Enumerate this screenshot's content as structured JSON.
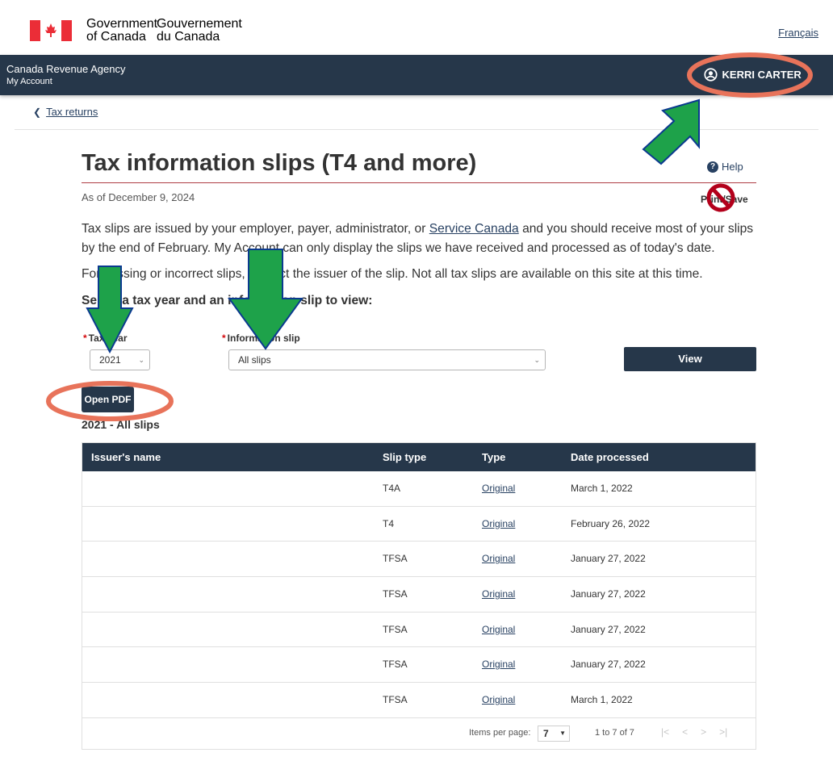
{
  "gov": {
    "name_en_1": "Government",
    "name_en_2": "of Canada",
    "name_fr_1": "Gouvernement",
    "name_fr_2": "du Canada",
    "lang_link": "Français"
  },
  "app_bar": {
    "agency": "Canada Revenue Agency",
    "app_name": "My Account",
    "user_name": "KERRI CARTER"
  },
  "breadcrumb": {
    "link": "Tax returns"
  },
  "page": {
    "title": "Tax information slips (T4 and more)",
    "help": "Help",
    "as_of": "As of December 9, 2024",
    "print_save": "Print/Save",
    "para1_before": "Tax slips are issued by your employer, payer, administrator, or ",
    "para1_link": "Service Canada",
    "para1_after": " and you should receive most of your slips by the end of February. My Account can only display the slips we have received and processed as of today's date.",
    "para2": "For missing or incorrect slips, contact the issuer of the slip. Not all tax slips are available on this site at this time.",
    "select_heading": "Select a tax year and an information slip to view:"
  },
  "form": {
    "tax_year_label": "Tax year",
    "tax_year_value": "2021",
    "slip_label": "Information slip",
    "slip_value": "All slips",
    "view_button": "View",
    "open_pdf_button": "Open PDF"
  },
  "table": {
    "caption": "2021 - All slips",
    "headers": [
      "Issuer's name",
      "Slip type",
      "Type",
      "Date processed"
    ],
    "rows": [
      {
        "issuer": "",
        "slip_type": "T4A",
        "type": "Original",
        "date": "March 1, 2022"
      },
      {
        "issuer": "",
        "slip_type": "T4",
        "type": "Original",
        "date": "February 26, 2022"
      },
      {
        "issuer": "",
        "slip_type": "TFSA",
        "type": "Original",
        "date": "January 27, 2022"
      },
      {
        "issuer": "",
        "slip_type": "TFSA",
        "type": "Original",
        "date": "January 27, 2022"
      },
      {
        "issuer": "",
        "slip_type": "TFSA",
        "type": "Original",
        "date": "January 27, 2022"
      },
      {
        "issuer": "",
        "slip_type": "TFSA",
        "type": "Original",
        "date": "January 27, 2022"
      },
      {
        "issuer": "",
        "slip_type": "TFSA",
        "type": "Original",
        "date": "March 1, 2022"
      }
    ],
    "items_per_page_label": "Items per page:",
    "items_per_page_value": "7",
    "range": "1 to 7 of 7"
  },
  "colors": {
    "header_navy": "#26374a",
    "link_blue": "#284162",
    "title_rule": "#af3c43",
    "annotation_circle": "#e8735a",
    "annotation_arrow": "#1ea24a"
  },
  "icons": [
    "canada-flag-icon",
    "user-circle-icon",
    "chevron-down-icon",
    "chevron-left-icon",
    "help-icon",
    "no-symbol-icon",
    "first-page-icon",
    "prev-page-icon",
    "next-page-icon",
    "last-page-icon"
  ]
}
